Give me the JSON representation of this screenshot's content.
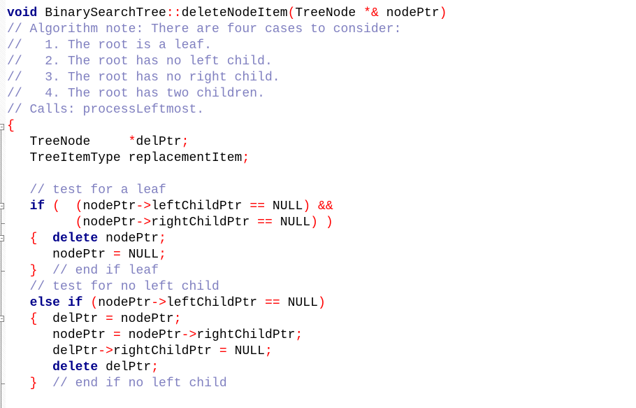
{
  "editor": {
    "lines": [
      [
        {
          "t": "void",
          "c": "kw"
        },
        {
          "t": " BinarySearchTree",
          "c": ""
        },
        {
          "t": "::",
          "c": "op"
        },
        {
          "t": "deleteNodeItem",
          "c": ""
        },
        {
          "t": "(",
          "c": "op"
        },
        {
          "t": "TreeNode ",
          "c": ""
        },
        {
          "t": "*&",
          "c": "op"
        },
        {
          "t": " nodePtr",
          "c": ""
        },
        {
          "t": ")",
          "c": "op"
        }
      ],
      [
        {
          "t": "// Algorithm note: There are four cases to consider:",
          "c": "cm"
        }
      ],
      [
        {
          "t": "//   1. The root is a leaf.",
          "c": "cm"
        }
      ],
      [
        {
          "t": "//   2. The root has no left child.",
          "c": "cm"
        }
      ],
      [
        {
          "t": "//   3. The root has no right child.",
          "c": "cm"
        }
      ],
      [
        {
          "t": "//   4. The root has two children.",
          "c": "cm"
        }
      ],
      [
        {
          "t": "// Calls: processLeftmost.",
          "c": "cm"
        }
      ],
      [
        {
          "t": "{",
          "c": "op"
        }
      ],
      [
        {
          "t": "   TreeNode     ",
          "c": ""
        },
        {
          "t": "*",
          "c": "op"
        },
        {
          "t": "delPtr",
          "c": ""
        },
        {
          "t": ";",
          "c": "op"
        }
      ],
      [
        {
          "t": "   TreeItemType replacementItem",
          "c": ""
        },
        {
          "t": ";",
          "c": "op"
        }
      ],
      [
        {
          "t": "",
          "c": ""
        }
      ],
      [
        {
          "t": "   // test for a leaf",
          "c": "cm"
        }
      ],
      [
        {
          "t": "   ",
          "c": ""
        },
        {
          "t": "if",
          "c": "kw"
        },
        {
          "t": " ",
          "c": ""
        },
        {
          "t": "(",
          "c": "op"
        },
        {
          "t": "  ",
          "c": ""
        },
        {
          "t": "(",
          "c": "op"
        },
        {
          "t": "nodePtr",
          "c": ""
        },
        {
          "t": "->",
          "c": "op"
        },
        {
          "t": "leftChildPtr ",
          "c": ""
        },
        {
          "t": "==",
          "c": "op"
        },
        {
          "t": " NULL",
          "c": ""
        },
        {
          "t": ")",
          "c": "op"
        },
        {
          "t": " ",
          "c": ""
        },
        {
          "t": "&&",
          "c": "op"
        }
      ],
      [
        {
          "t": "         ",
          "c": ""
        },
        {
          "t": "(",
          "c": "op"
        },
        {
          "t": "nodePtr",
          "c": ""
        },
        {
          "t": "->",
          "c": "op"
        },
        {
          "t": "rightChildPtr ",
          "c": ""
        },
        {
          "t": "==",
          "c": "op"
        },
        {
          "t": " NULL",
          "c": ""
        },
        {
          "t": ")",
          "c": "op"
        },
        {
          "t": " ",
          "c": ""
        },
        {
          "t": ")",
          "c": "op"
        }
      ],
      [
        {
          "t": "   ",
          "c": ""
        },
        {
          "t": "{",
          "c": "op"
        },
        {
          "t": "  ",
          "c": ""
        },
        {
          "t": "delete",
          "c": "kw"
        },
        {
          "t": " nodePtr",
          "c": ""
        },
        {
          "t": ";",
          "c": "op"
        }
      ],
      [
        {
          "t": "      nodePtr ",
          "c": ""
        },
        {
          "t": "=",
          "c": "op"
        },
        {
          "t": " NULL",
          "c": ""
        },
        {
          "t": ";",
          "c": "op"
        }
      ],
      [
        {
          "t": "   ",
          "c": ""
        },
        {
          "t": "}",
          "c": "op"
        },
        {
          "t": "  // end if leaf",
          "c": "cm"
        }
      ],
      [
        {
          "t": "   // test for no left child",
          "c": "cm"
        }
      ],
      [
        {
          "t": "   ",
          "c": ""
        },
        {
          "t": "else if",
          "c": "kw"
        },
        {
          "t": " ",
          "c": ""
        },
        {
          "t": "(",
          "c": "op"
        },
        {
          "t": "nodePtr",
          "c": ""
        },
        {
          "t": "->",
          "c": "op"
        },
        {
          "t": "leftChildPtr ",
          "c": ""
        },
        {
          "t": "==",
          "c": "op"
        },
        {
          "t": " NULL",
          "c": ""
        },
        {
          "t": ")",
          "c": "op"
        }
      ],
      [
        {
          "t": "   ",
          "c": ""
        },
        {
          "t": "{",
          "c": "op"
        },
        {
          "t": "  delPtr ",
          "c": ""
        },
        {
          "t": "=",
          "c": "op"
        },
        {
          "t": " nodePtr",
          "c": ""
        },
        {
          "t": ";",
          "c": "op"
        }
      ],
      [
        {
          "t": "      nodePtr ",
          "c": ""
        },
        {
          "t": "=",
          "c": "op"
        },
        {
          "t": " nodePtr",
          "c": ""
        },
        {
          "t": "->",
          "c": "op"
        },
        {
          "t": "rightChildPtr",
          "c": ""
        },
        {
          "t": ";",
          "c": "op"
        }
      ],
      [
        {
          "t": "      delPtr",
          "c": ""
        },
        {
          "t": "->",
          "c": "op"
        },
        {
          "t": "rightChildPtr ",
          "c": ""
        },
        {
          "t": "=",
          "c": "op"
        },
        {
          "t": " NULL",
          "c": ""
        },
        {
          "t": ";",
          "c": "op"
        }
      ],
      [
        {
          "t": "      ",
          "c": ""
        },
        {
          "t": "delete",
          "c": "kw"
        },
        {
          "t": " delPtr",
          "c": ""
        },
        {
          "t": ";",
          "c": "op"
        }
      ],
      [
        {
          "t": "   ",
          "c": ""
        },
        {
          "t": "}",
          "c": "op"
        },
        {
          "t": "  // end if no left child",
          "c": "cm"
        }
      ]
    ]
  }
}
